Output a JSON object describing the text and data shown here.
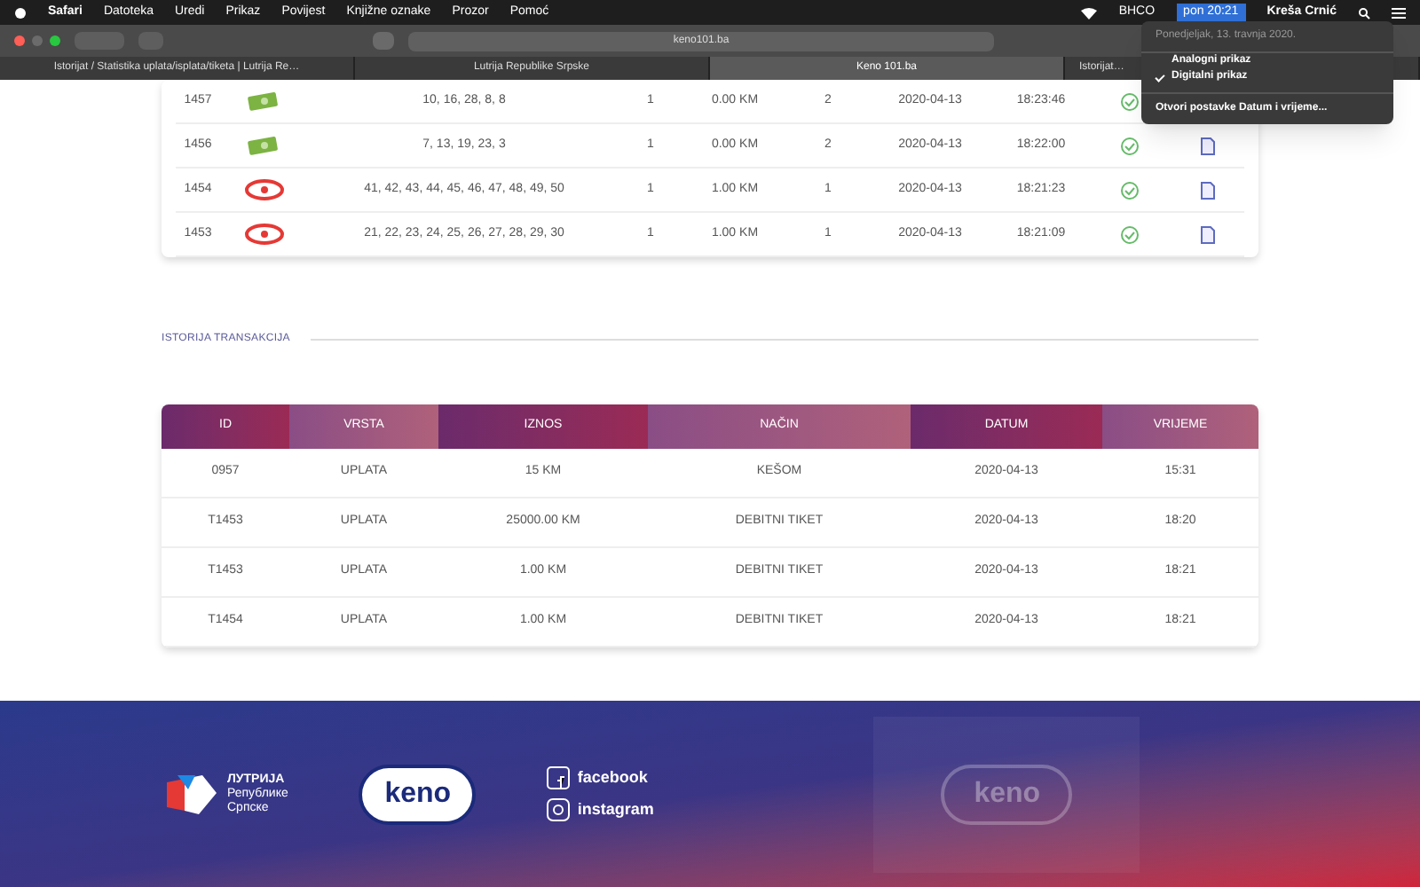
{
  "menu_bar": {
    "items": [
      "Safari",
      "Datoteka",
      "Uredi",
      "Prikaz",
      "Povijest",
      "Knjižne oznake",
      "Prozor",
      "Pomoć"
    ],
    "status": "BHCO",
    "clock": "pon 20:21",
    "user": "Kreša Crnić"
  },
  "clock_menu": {
    "date": "Ponedjeljak, 13. travnja 2020.",
    "options": [
      {
        "label": "Analogni prikaz",
        "checked": false
      },
      {
        "label": "Digitalni prikaz",
        "checked": true
      }
    ],
    "settings": "Otvori postavke Datum i vrijeme..."
  },
  "browser": {
    "url": "keno101.ba",
    "tabs": [
      {
        "label": "Istorijat / Statistika uplata/isplata/tiketa | Lutrija Re…",
        "selected": false
      },
      {
        "label": "Lutrija Republike Srpske",
        "selected": false
      },
      {
        "label": "Keno 101.ba",
        "selected": true
      },
      {
        "label": "Istorijat…",
        "selected": false
      }
    ]
  },
  "tickets": {
    "rows": [
      {
        "id": "1457",
        "kind": "cash",
        "numbers": "10, 16, 28, 8, 8",
        "col_4": "1",
        "amount": "0.00 KM",
        "col_6": "2",
        "date": "2020-04-13",
        "time": "18:23:46"
      },
      {
        "id": "1456",
        "kind": "cash",
        "numbers": "7, 13, 19, 23, 3",
        "col_4": "1",
        "amount": "0.00 KM",
        "col_6": "2",
        "date": "2020-04-13",
        "time": "18:22:00"
      },
      {
        "id": "1454",
        "kind": "keno",
        "numbers": "41, 42, 43, 44, 45, 46, 47, 48, 49, 50",
        "col_4": "1",
        "amount": "1.00 KM",
        "col_6": "1",
        "date": "2020-04-13",
        "time": "18:21:23"
      },
      {
        "id": "1453",
        "kind": "keno",
        "numbers": "21, 22, 23, 24, 25, 26, 27, 28, 29, 30",
        "col_4": "1",
        "amount": "1.00 KM",
        "col_6": "1",
        "date": "2020-04-13",
        "time": "18:21:09"
      }
    ]
  },
  "transactions": {
    "title": "ISTORIJA TRANSAKCIJA",
    "columns": [
      "ID",
      "VRSTA",
      "IZNOS",
      "NAČIN",
      "DATUM",
      "VRIJEME"
    ],
    "rows": [
      [
        "0957",
        "UPLATA",
        "15 KM",
        "KEŠOM",
        "2020-04-13",
        "15:31"
      ],
      [
        "T1453",
        "UPLATA",
        "25000.00 KM",
        "DEBITNI TIKET",
        "2020-04-13",
        "18:20"
      ],
      [
        "T1453",
        "UPLATA",
        "1.00 KM",
        "DEBITNI TIKET",
        "2020-04-13",
        "18:21"
      ],
      [
        "T1454",
        "UPLATA",
        "1.00 KM",
        "DEBITNI TIKET",
        "2020-04-13",
        "18:21"
      ]
    ]
  },
  "footer": {
    "lottery_logo": [
      "ЛУТРИЈА",
      "Републике",
      "Српске"
    ],
    "keno_logo": "keno",
    "links": [
      {
        "kind": "facebook",
        "label": "facebook"
      },
      {
        "kind": "instagram",
        "label": "instagram"
      }
    ],
    "promo_logo": "keno"
  }
}
